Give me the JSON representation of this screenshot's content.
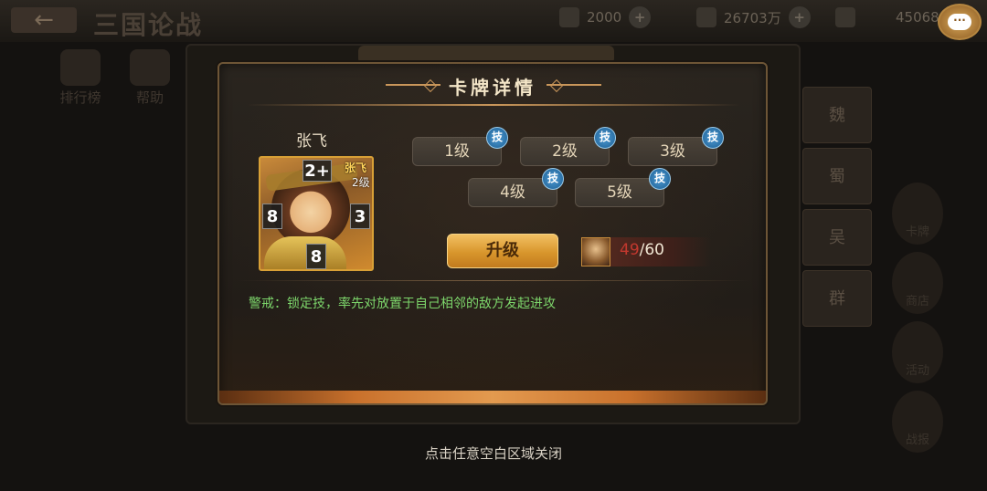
{
  "background": {
    "back_icon": "back-arrow-icon",
    "title": "三国论战",
    "resources": [
      {
        "icon": "stamina-icon",
        "value": "2000"
      },
      {
        "icon": "coin-icon",
        "value": "26703万"
      },
      {
        "icon": "ingot-icon",
        "value": "45068"
      }
    ],
    "left_menu": [
      "排行榜",
      "帮助"
    ],
    "faction_tabs": [
      "魏",
      "蜀",
      "吴",
      "群"
    ],
    "right_menu": [
      "卡牌",
      "商店",
      "活动",
      "战报"
    ]
  },
  "modal": {
    "title": "卡牌详情",
    "card": {
      "name": "张飞",
      "card_name": "张飞",
      "card_level": "2级",
      "stats": {
        "top": "2+",
        "left": "8",
        "right": "3",
        "bottom": "8"
      }
    },
    "level_buttons": [
      {
        "label": "1级",
        "badge": "技"
      },
      {
        "label": "2级",
        "badge": "技"
      },
      {
        "label": "3级",
        "badge": "技"
      },
      {
        "label": "4级",
        "badge": "技"
      },
      {
        "label": "5级",
        "badge": "技"
      }
    ],
    "upgrade_label": "升级",
    "shards": {
      "current": "49",
      "total": "/60"
    },
    "skill_description": "警戒：锁定技，率先对放置于自己相邻的敌方发起进攻"
  },
  "close_hint": "点击任意空白区域关闭",
  "colors": {
    "accent_gold": "#d8962c",
    "skill_badge": "#1d5f94",
    "skill_text": "#7dd66b",
    "shard_current": "#c3382e"
  }
}
